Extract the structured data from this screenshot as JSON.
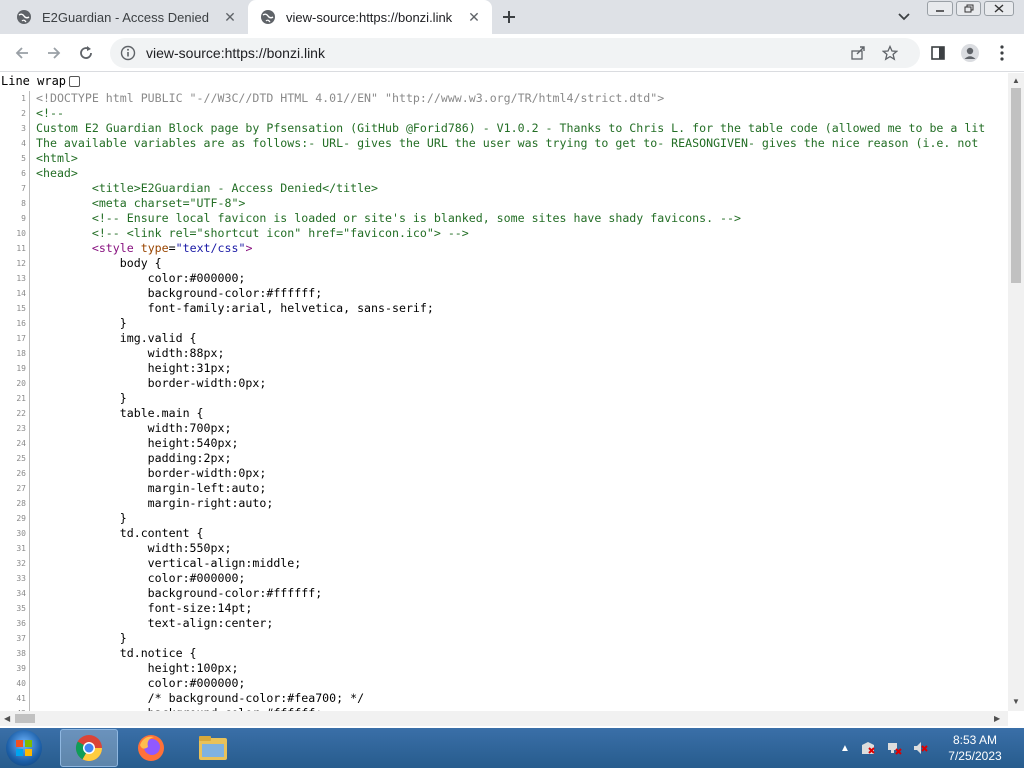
{
  "tabs": [
    {
      "title": "E2Guardian - Access Denied",
      "active": false
    },
    {
      "title": "view-source:https://bonzi.link",
      "active": true
    }
  ],
  "omnibox": {
    "url": "view-source:https://bonzi.link"
  },
  "linewrap": {
    "label": "Line wrap"
  },
  "source_lines": [
    "<!DOCTYPE html PUBLIC \"-//W3C//DTD HTML 4.01//EN\" \"http://www.w3.org/TR/html4/strict.dtd\">",
    "<!--",
    "Custom E2 Guardian Block page by Pfsensation (GitHub @Forid786) - V1.0.2 - Thanks to Chris L. for the table code (allowed me to be a lit",
    "The available variables are as follows:- URL- gives the URL the user was trying to get to- REASONGIVEN- gives the nice reason (i.e. not",
    "<html>",
    "<head>",
    "        <title>E2Guardian - Access Denied</title>",
    "        <meta charset=\"UTF-8\">",
    "        <!-- Ensure local favicon is loaded or site's is blanked, some sites have shady favicons. -->",
    "        <!-- <link rel=\"shortcut icon\" href=\"favicon.ico\"> -->",
    "        <style type=\"text/css\">",
    "            body {",
    "                color:#000000;",
    "                background-color:#ffffff;",
    "                font-family:arial, helvetica, sans-serif;",
    "            }",
    "            img.valid {",
    "                width:88px;",
    "                height:31px;",
    "                border-width:0px;",
    "            }",
    "            table.main {",
    "                width:700px;",
    "                height:540px;",
    "                padding:2px;",
    "                border-width:0px;",
    "                margin-left:auto;",
    "                margin-right:auto;",
    "            }",
    "            td.content {",
    "                width:550px;",
    "                vertical-align:middle;",
    "                color:#000000;",
    "                background-color:#ffffff;",
    "                font-size:14pt;",
    "                text-align:center;",
    "            }",
    "            td.notice {",
    "                height:100px;",
    "                color:#000000;",
    "                /* background-color:#fea700; */",
    "                background-color:#ffffff;"
  ],
  "selected_text": "ked, some sites have shady favicons.",
  "clock": {
    "time": "8:53 AM",
    "date": "7/25/2023"
  },
  "colors": {
    "tab_strip": "#dee1e6",
    "selection": "#1a73e8",
    "taskbar": "#275c8d"
  }
}
